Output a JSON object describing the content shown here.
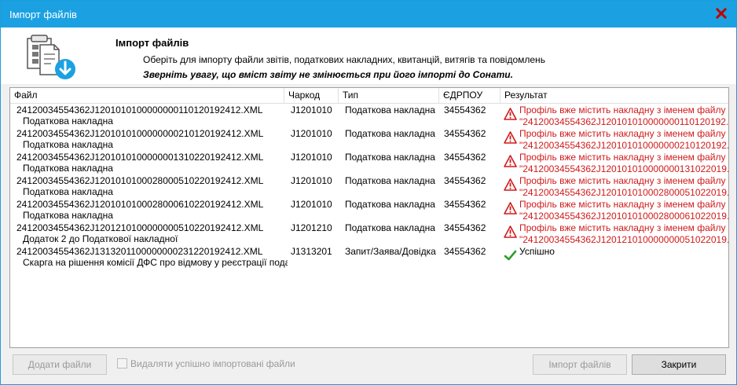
{
  "window": {
    "title": "Імпорт файлів"
  },
  "header": {
    "title": "Імпорт файлів",
    "subtitle": "Оберіть для імпорту файли звітів, податкових накладних, квитанцій, витягів та повідомлень",
    "warning": "Зверніть увагу, що вміст звіту не змінюється при його імпорті до Сонати."
  },
  "table": {
    "columns": [
      "Файл",
      "Чаркод",
      "Тип",
      "ЄДРПОУ",
      "Результат"
    ],
    "rows": [
      {
        "file": "24120034554362J1201010100000000110120192412.XML",
        "doc": "Податкова накладна",
        "code": "J1201010",
        "type": "Податкова накладна",
        "edrpou": "34554362",
        "result_line1": "Профіль вже містить накладну з іменем файлу",
        "result_line2": "\"24120034554362J120101010000000110120192...",
        "status": "error"
      },
      {
        "file": "24120034554362J1201010100000000210120192412.XML",
        "doc": "Податкова накладна",
        "code": "J1201010",
        "type": "Податкова накладна",
        "edrpou": "34554362",
        "result_line1": "Профіль вже містить накладну з іменем файлу",
        "result_line2": "\"24120034554362J120101010000000210120192...",
        "status": "error"
      },
      {
        "file": "24120034554362J1201010100000001310220192412.XML",
        "doc": "Податкова накладна",
        "code": "J1201010",
        "type": "Податкова накладна",
        "edrpou": "34554362",
        "result_line1": "Профіль вже містить накладну з іменем файлу",
        "result_line2": "\"24120034554362J120101010000000131022019...",
        "status": "error"
      },
      {
        "file": "24120034554362J1201010100028000510220192412.XML",
        "doc": "Податкова накладна",
        "code": "J1201010",
        "type": "Податкова накладна",
        "edrpou": "34554362",
        "result_line1": "Профіль вже містить накладну з іменем файлу",
        "result_line2": "\"24120034554362J120101010002800051022019...",
        "status": "error"
      },
      {
        "file": "24120034554362J1201010100028000610220192412.XML",
        "doc": "Податкова накладна",
        "code": "J1201010",
        "type": "Податкова накладна",
        "edrpou": "34554362",
        "result_line1": "Профіль вже містить накладну з іменем файлу",
        "result_line2": "\"24120034554362J120101010002800061022019...",
        "status": "error"
      },
      {
        "file": "24120034554362J1201210100000000510220192412.XML",
        "doc": "Додаток 2 до Податкової накладної",
        "code": "J1201210",
        "type": "Податкова накладна",
        "edrpou": "34554362",
        "result_line1": "Профіль вже містить накладну з іменем файлу",
        "result_line2": "\"24120034554362J120121010000000051022019...",
        "status": "error"
      },
      {
        "file": "24120034554362J1313201100000000231220192412.XML",
        "doc": "Скарга на рішення комісії ДФС про відмову у реєстрації подат...",
        "code": "J1313201",
        "type": "Запит/Заява/Довідка",
        "edrpou": "34554362",
        "result_line1": "Успішно",
        "result_line2": "",
        "status": "ok"
      }
    ]
  },
  "footer": {
    "add_files": "Додати файли",
    "delete_imported": "Видаляти успішно імпортовані файли",
    "import_files": "Імпорт файлів",
    "close": "Закрити"
  },
  "colors": {
    "titlebar": "#1ba1e2",
    "error": "#d11a1a",
    "success": "#2e9e2e"
  },
  "icons": {
    "header": "import-documents-icon",
    "error": "warning-triangle-icon",
    "ok": "checkmark-icon",
    "close": "close-icon"
  }
}
